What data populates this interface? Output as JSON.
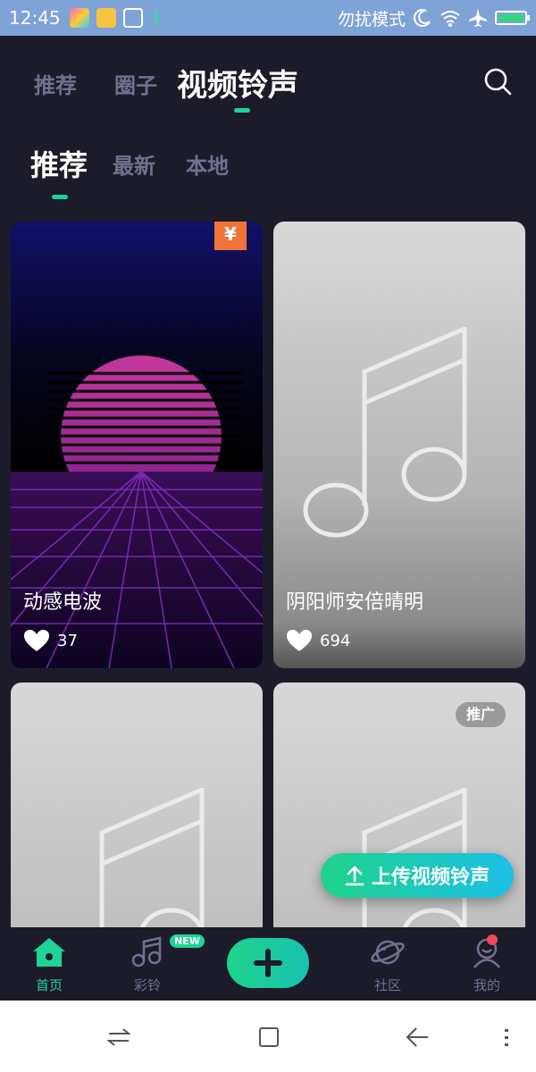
{
  "status_bar": {
    "time": "12:45",
    "dnd_label": "勿扰模式",
    "icons": [
      "app-icon",
      "folder-icon",
      "cleaner-icon",
      "usb-icon",
      "moon-icon",
      "wifi-icon",
      "airplane-icon",
      "battery-icon"
    ]
  },
  "top_tabs": [
    {
      "label": "推荐",
      "active": false
    },
    {
      "label": "圈子",
      "active": false
    },
    {
      "label": "视频铃声",
      "active": true
    }
  ],
  "sub_tabs": [
    {
      "label": "推荐",
      "active": true
    },
    {
      "label": "最新",
      "active": false
    },
    {
      "label": "本地",
      "active": false
    }
  ],
  "cards": [
    {
      "title": "动感电波",
      "likes": "37",
      "badge": "¥"
    },
    {
      "title": "阴阳师安倍晴明",
      "likes": "694"
    },
    {
      "title": ""
    },
    {
      "title": "",
      "badge": "推广"
    }
  ],
  "upload_button": {
    "label": "上传视频铃声"
  },
  "bottom_nav": {
    "items": [
      {
        "label": "首页",
        "icon": "home-icon",
        "active": true
      },
      {
        "label": "彩铃",
        "icon": "music-note-icon",
        "badge": "NEW"
      },
      {
        "label": "",
        "icon": "plus-icon"
      },
      {
        "label": "社区",
        "icon": "planet-icon"
      },
      {
        "label": "我的",
        "icon": "user-icon"
      }
    ]
  },
  "colors": {
    "accent": "#1ed494",
    "background": "#1c1b2a",
    "muted": "#6f7190",
    "vip": "#f2723a"
  }
}
